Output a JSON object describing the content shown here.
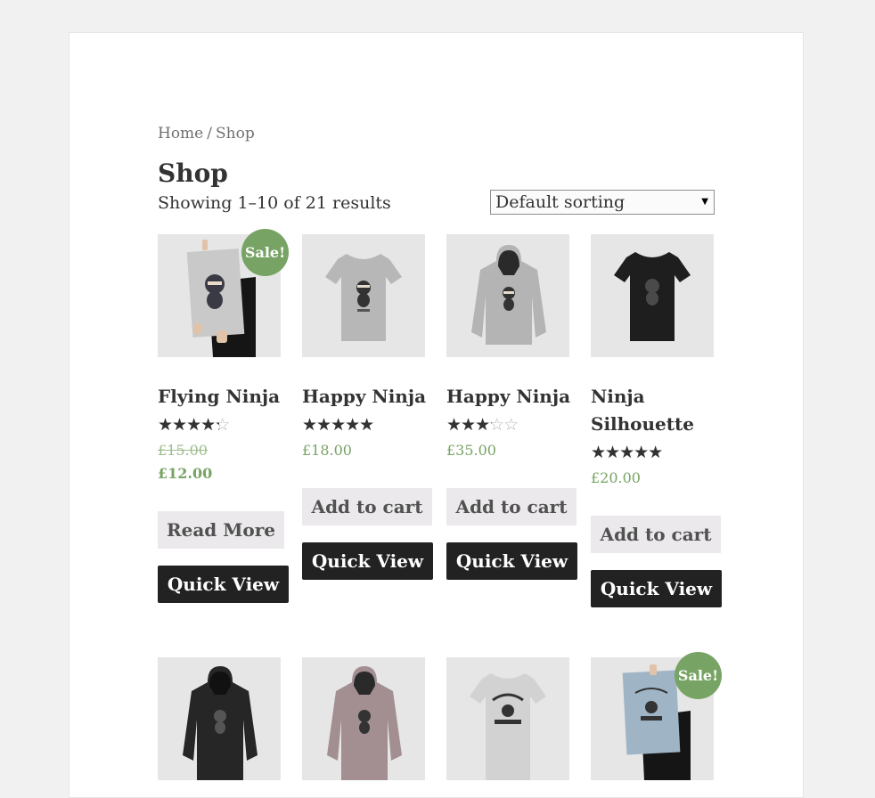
{
  "breadcrumb": {
    "home": "Home",
    "separator": "/",
    "current": "Shop"
  },
  "page_title": "Shop",
  "result_count": "Showing 1–10 of 21 results",
  "sorting": {
    "selected": "Default sorting",
    "arrow_icon": "triangle-down"
  },
  "colors": {
    "sale_badge": "#77a464",
    "price": "#77a464",
    "dark_button": "#222222",
    "light_button": "#ebe9eb"
  },
  "products": [
    {
      "title": "Flying Ninja",
      "rating": 4,
      "price_old": "£15.00",
      "price": "£12.00",
      "sale": "Sale!",
      "primary_button": "Read More",
      "quick_view": "Quick View",
      "image": "poster-ninja"
    },
    {
      "title": "Happy Ninja",
      "rating": 5,
      "price": "£18.00",
      "primary_button": "Add to cart",
      "quick_view": "Quick View",
      "image": "grey-tshirt-ninja"
    },
    {
      "title": "Happy Ninja",
      "rating": 3,
      "price": "£35.00",
      "primary_button": "Add to cart",
      "quick_view": "Quick View",
      "image": "grey-hoodie-ninja"
    },
    {
      "title": "Ninja Silhouette",
      "rating": 5,
      "price": "£20.00",
      "primary_button": "Add to cart",
      "quick_view": "Quick View",
      "image": "black-tshirt-ninja"
    },
    {
      "image": "black-hoodie"
    },
    {
      "image": "pink-hoodie"
    },
    {
      "image": "white-tshirt-woothemes"
    },
    {
      "sale": "Sale!",
      "image": "poster-woothemes"
    }
  ]
}
